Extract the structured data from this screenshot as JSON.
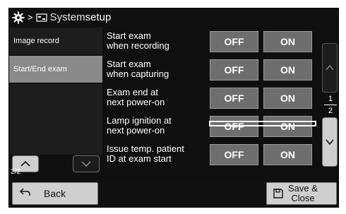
{
  "header": {
    "breadcrumb_sep": ">",
    "title_part1": "System",
    "title_part2": " setup"
  },
  "sidebar": {
    "items": [
      {
        "label": "Image record"
      },
      {
        "label": "Start/End exam"
      }
    ],
    "page_indicator": "2/2"
  },
  "settings": [
    {
      "label_line1": "Start exam",
      "label_line2": "when recording",
      "off": "OFF",
      "on": "ON"
    },
    {
      "label_line1": "Start exam",
      "label_line2": "when capturing",
      "off": "OFF",
      "on": "ON"
    },
    {
      "label_line1": "Exam end at",
      "label_line2": "next power-on",
      "off": "OFF",
      "on": "ON"
    },
    {
      "label_line1": "Lamp ignition at",
      "label_line2": "next power-on",
      "off": "OFF",
      "on": "ON"
    },
    {
      "label_line1": "Issue temp. patient",
      "label_line2": "ID at exam start",
      "off": "OFF",
      "on": "ON"
    }
  ],
  "scroll": {
    "page_current": "1",
    "page_total": "2"
  },
  "footer": {
    "back_label": "Back",
    "save_line1": "Save &",
    "save_line2": "Close"
  },
  "icons": {
    "settings": "gear-icon",
    "system": "system-setup-icon",
    "back": "back-arrow-icon",
    "save": "save-icon",
    "up": "chevron-up-icon",
    "down": "chevron-down-icon"
  }
}
